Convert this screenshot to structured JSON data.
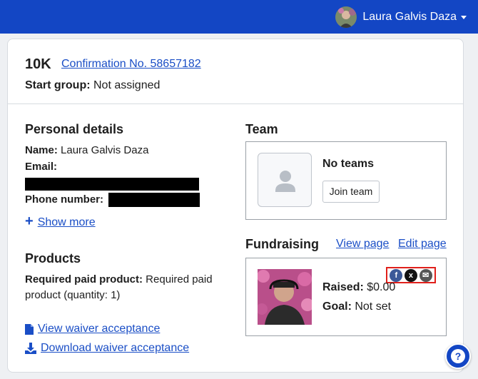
{
  "header": {
    "user_name": "Laura Galvis Daza",
    "brand_color": "#1346c4"
  },
  "registration": {
    "event": "10K",
    "confirmation": "Confirmation No. 58657182",
    "start_group_label": "Start group:",
    "start_group_value": "Not assigned"
  },
  "personal": {
    "heading": "Personal details",
    "name_label": "Name:",
    "name_value": "Laura Galvis Daza",
    "email_label": "Email:",
    "phone_label": "Phone number:",
    "show_more": "Show more"
  },
  "products": {
    "heading": "Products",
    "label": "Required paid product:",
    "value": "Required paid product (quantity: 1)"
  },
  "waiver": {
    "view": "View waiver acceptance",
    "download": "Download waiver acceptance"
  },
  "team": {
    "heading": "Team",
    "status": "No teams",
    "join": "Join team"
  },
  "fundraising": {
    "heading": "Fundraising",
    "view_page": "View page",
    "edit_page": "Edit page",
    "raised_label": "Raised:",
    "raised_value": "$0.00",
    "goal_label": "Goal:",
    "goal_value": "Not set",
    "share_icons": [
      "facebook-icon",
      "x-icon",
      "email-icon"
    ],
    "highlight_color": "#e0201b"
  }
}
